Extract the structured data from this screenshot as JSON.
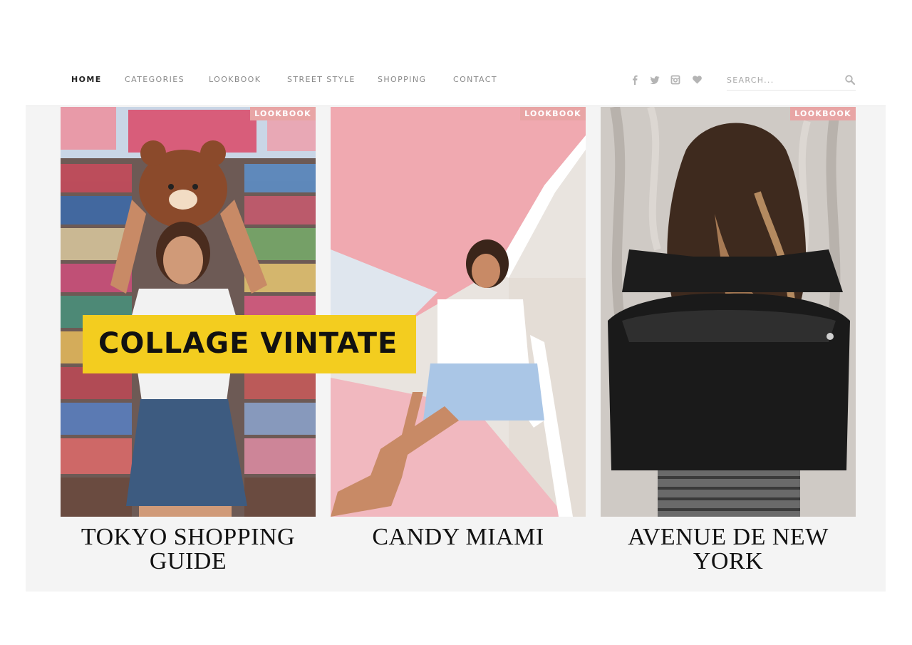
{
  "nav": {
    "items": [
      {
        "label": "HOME",
        "active": true
      },
      {
        "label": "CATEGORIES",
        "active": false
      },
      {
        "label": "LOOKBOOK",
        "active": false
      },
      {
        "label": "STREET STYLE",
        "active": false
      },
      {
        "label": "SHOPPING",
        "active": false
      },
      {
        "label": "CONTACT",
        "active": false
      }
    ],
    "social": [
      "facebook-icon",
      "twitter-icon",
      "instagram-icon",
      "heart-icon"
    ]
  },
  "search": {
    "placeholder": "SEARCH...",
    "value": ""
  },
  "cards": [
    {
      "tag": "LOOKBOOK",
      "title": "TOKYO SHOPPING GUIDE"
    },
    {
      "tag": "LOOKBOOK",
      "title": "CANDY MIAMI"
    },
    {
      "tag": "LOOKBOOK",
      "title": "AVENUE DE NEW YORK"
    }
  ],
  "banner": {
    "text": "COLLAGE VINTATE"
  },
  "colors": {
    "tag_bg": "#e8a5a5",
    "banner_bg": "#f3cd1f",
    "content_bg": "#f4f4f4"
  }
}
